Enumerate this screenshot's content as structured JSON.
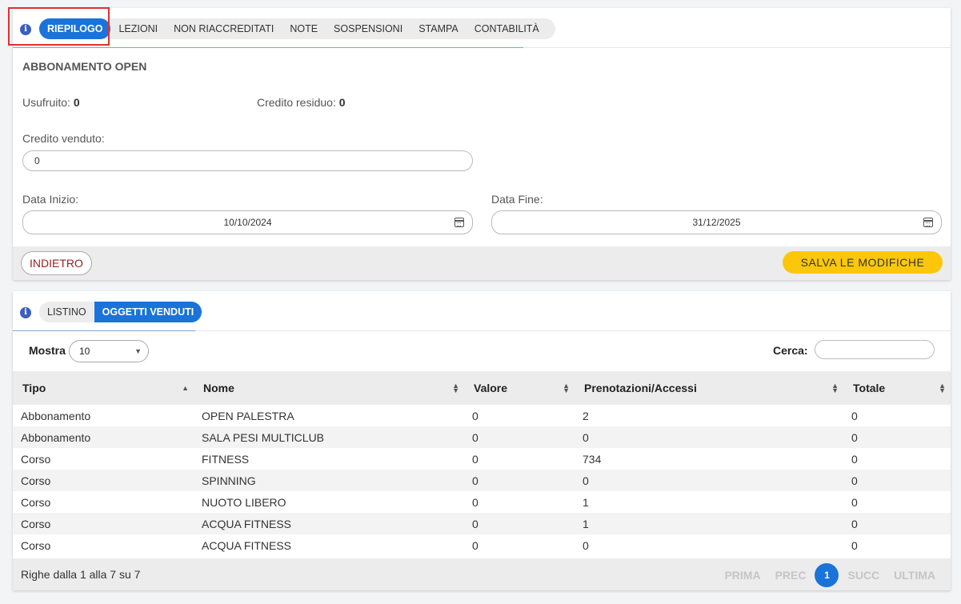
{
  "panel1": {
    "tabs": [
      "RIEPILOGO",
      "LEZIONI",
      "NON RIACCREDITATI",
      "NOTE",
      "SOSPENSIONI",
      "STAMPA",
      "CONTABILITÀ"
    ],
    "title": "ABBONAMENTO OPEN",
    "usufruito_label": "Usufruito:",
    "usufruito_value": "0",
    "credito_residuo_label": "Credito residuo:",
    "credito_residuo_value": "0",
    "credito_venduto_label": "Credito venduto:",
    "credito_venduto_value": "0",
    "data_inizio_label": "Data Inizio:",
    "data_inizio_value": "10/10/2024",
    "data_fine_label": "Data Fine:",
    "data_fine_value": "31/12/2025",
    "back_label": "INDIETRO",
    "save_label": "SALVA LE MODIFICHE"
  },
  "panel2": {
    "tabs": [
      "LISTINO",
      "OGGETTI VENDUTI"
    ],
    "show_label": "Mostra",
    "show_value": "10",
    "search_label": "Cerca:",
    "columns": [
      "Tipo",
      "Nome",
      "Valore",
      "Prenotazioni/Accessi",
      "Totale"
    ],
    "rows": [
      [
        "Abbonamento",
        "OPEN PALESTRA",
        "0",
        "2",
        "0"
      ],
      [
        "Abbonamento",
        "SALA PESI MULTICLUB",
        "0",
        "0",
        "0"
      ],
      [
        "Corso",
        "FITNESS",
        "0",
        "734",
        "0"
      ],
      [
        "Corso",
        "SPINNING",
        "0",
        "0",
        "0"
      ],
      [
        "Corso",
        "NUOTO LIBERO",
        "0",
        "1",
        "0"
      ],
      [
        "Corso",
        "ACQUA FITNESS",
        "0",
        "1",
        "0"
      ],
      [
        "Corso",
        "ACQUA FITNESS",
        "0",
        "0",
        "0"
      ]
    ],
    "info": "Righe dalla 1 alla 7 su 7",
    "pager": {
      "first": "PRIMA",
      "prev": "PREC",
      "current": "1",
      "next": "SUCC",
      "last": "ULTIMA"
    }
  },
  "colors": {
    "accent": "#1a73d9",
    "save": "#fcc70a",
    "back_text": "#9a1e1e",
    "highlight": "#e03030"
  }
}
